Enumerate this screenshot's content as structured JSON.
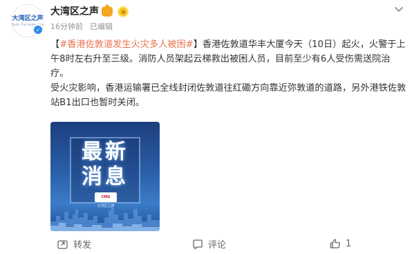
{
  "post": {
    "avatar": {
      "name": "大湾区之声",
      "subtitle": "Radio The Greater Bay"
    },
    "account_name": "大湾区之声",
    "meta": {
      "time": "16分钟前",
      "edited": "已编辑"
    },
    "content": {
      "bracket_open": "【",
      "topic": "#香港佐敦道发生火灾多人被困#",
      "bracket_close": "】",
      "p1_text": "香港佐敦道华丰大厦今天（10日）起火，火警于上午8时左右升至三级。消防人员架起云梯救出被困人员，目前至少有6人受伤需送院治疗。",
      "p2_text": "受火灾影响，香港运输署已全线封闭佐敦道往红磡方向靠近弥敦道的道路，另外港铁佐敦站B1出口也暂时关闭。"
    },
    "image": {
      "headline_line1": "最新",
      "headline_line2": "消息",
      "logo_text": "CMG",
      "logo_caption": "大湾区之声"
    }
  },
  "actions": {
    "share_label": "转发",
    "comment_label": "评论",
    "like_count": "1"
  },
  "icons": {
    "verify": "verified-badge-icon",
    "more": "chevron-down-icon",
    "share": "share-icon",
    "comment": "comment-icon",
    "like": "thumbs-up-icon"
  },
  "colors": {
    "topic": "#eb7350",
    "verify": "#2b8ce6",
    "meta": "#939393"
  }
}
